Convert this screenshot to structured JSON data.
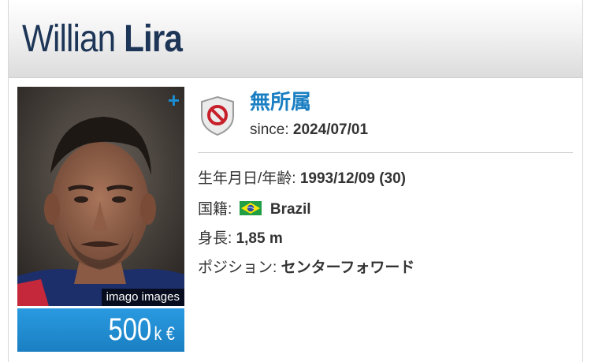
{
  "player": {
    "first_name": "Willian",
    "last_name": "Lira",
    "photo_credit": "imago images",
    "add_symbol": "+"
  },
  "market_value": {
    "amount": "500",
    "unit": "k €"
  },
  "club": {
    "name": "無所属",
    "since_label": "since:",
    "since_date": "2024/07/01",
    "badge_icon": "no-club-icon"
  },
  "details": {
    "birth_label": "生年月日/年齢:",
    "birth_value": "1993/12/09 (30)",
    "nationality_label": "国籍:",
    "nationality_value": "Brazil",
    "nationality_flag": "brazil-flag-icon",
    "height_label": "身長:",
    "height_value": "1,85 m",
    "position_label": "ポジション:",
    "position_value": "センターフォワード"
  },
  "colors": {
    "accent": "#1a7fc2",
    "title": "#1d3557"
  }
}
